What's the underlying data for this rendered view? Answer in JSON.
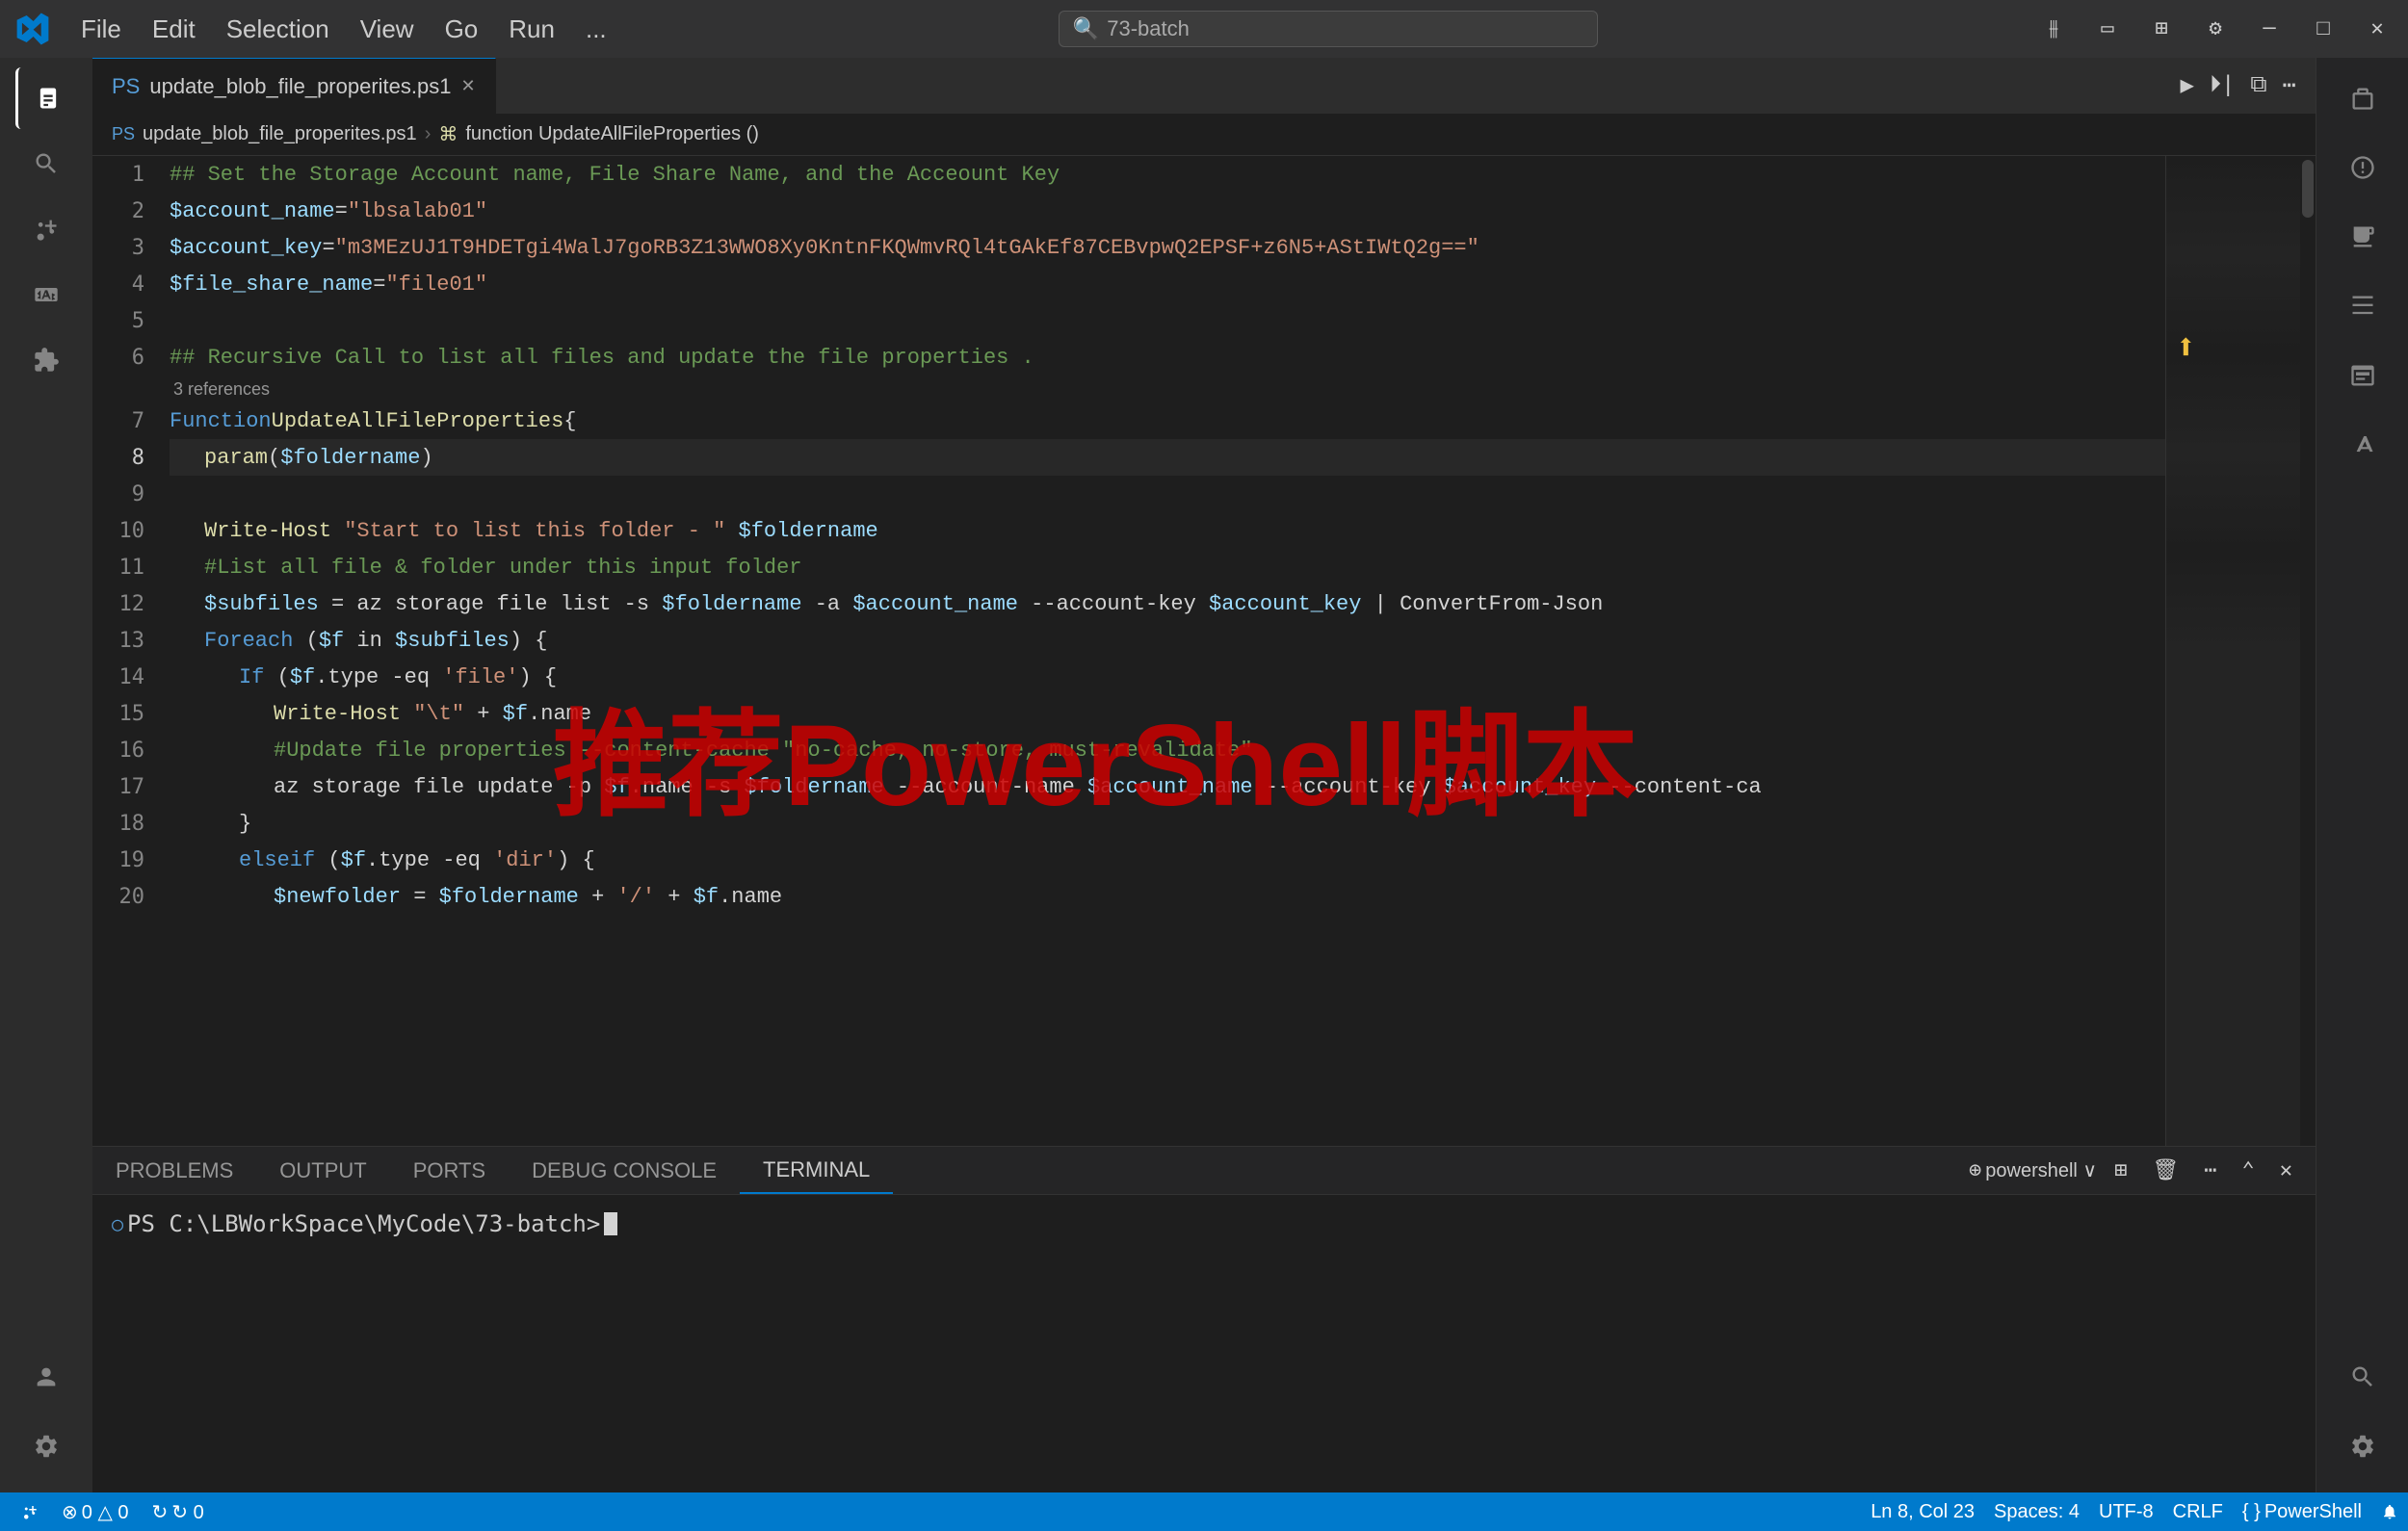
{
  "titleBar": {
    "logoAlt": "VS Code Logo",
    "menuItems": [
      "File",
      "Edit",
      "Selection",
      "View",
      "Go",
      "Run",
      "..."
    ],
    "searchPlaceholder": "73-batch",
    "windowControls": [
      "minimize",
      "maximize",
      "restore",
      "close"
    ]
  },
  "tabs": [
    {
      "label": "update_blob_file_properites.ps1",
      "active": true,
      "modified": false
    }
  ],
  "breadcrumb": {
    "parts": [
      "update_blob_file_properites.ps1",
      "function UpdateAllFileProperties ()"
    ]
  },
  "code": {
    "lines": [
      {
        "num": 1,
        "content": "## Set the Storage Account name, File Share Name, and the Acceount Key",
        "type": "comment"
      },
      {
        "num": 2,
        "content": "$account_name = \"lbsalab01\"",
        "type": "code"
      },
      {
        "num": 3,
        "content": "$account_key = \"m3MEzUJ1T9HDETgi4WalJ7goRB3Z13WWO8Xy0KntnFKQWmvRQl4tGAkEf87CEBvpwQ2EPSF+z6N5+AStIWtQ2g==\"",
        "type": "code"
      },
      {
        "num": 4,
        "content": "$file_share_name = \"file01\"",
        "type": "code"
      },
      {
        "num": 5,
        "content": "",
        "type": "empty"
      },
      {
        "num": 6,
        "content": "## Recursive Call to list all files and update the file properties .",
        "type": "comment"
      },
      {
        "num": "refs",
        "content": "3 references",
        "type": "refs"
      },
      {
        "num": 7,
        "content": "Function UpdateAllFileProperties {",
        "type": "code"
      },
      {
        "num": 8,
        "content": "    param($foldername)",
        "type": "code",
        "active": true
      },
      {
        "num": 9,
        "content": "",
        "type": "empty"
      },
      {
        "num": 10,
        "content": "    Write-Host \"Start to list this folder - \"  $foldername",
        "type": "code"
      },
      {
        "num": 11,
        "content": "    #List all file & folder under this input folder",
        "type": "comment"
      },
      {
        "num": 12,
        "content": "    $subfiles = az storage file list -s $foldername -a $account_name --account-key $account_key |  ConvertFrom-Json",
        "type": "code"
      },
      {
        "num": 13,
        "content": "    Foreach ($f in $subfiles) {",
        "type": "code"
      },
      {
        "num": 14,
        "content": "        If ($f.type -eq 'file') {",
        "type": "code"
      },
      {
        "num": 15,
        "content": "            Write-Host \"\\t\" + $f.name",
        "type": "code"
      },
      {
        "num": 16,
        "content": "            #Update file properties  --content-cache \"no-cache, no-store, must-revalidate\"",
        "type": "comment"
      },
      {
        "num": 17,
        "content": "            az storage file update -p $f.name -s $foldername --account-name $account_name --account-key $account_key --content-ca",
        "type": "code"
      },
      {
        "num": 18,
        "content": "        }",
        "type": "code"
      },
      {
        "num": 19,
        "content": "        elseif ($f.type -eq 'dir') {",
        "type": "code"
      },
      {
        "num": 20,
        "content": "            $newfolder = $foldername + '/' + $f.name",
        "type": "code"
      }
    ]
  },
  "panel": {
    "tabs": [
      "PROBLEMS",
      "OUTPUT",
      "PORTS",
      "DEBUG CONSOLE",
      "TERMINAL"
    ],
    "activeTab": "TERMINAL",
    "terminalShell": "powershell",
    "terminalPrompt": "PS C:\\LBWorkSpace\\MyCode\\73-batch> "
  },
  "statusBar": {
    "gitBranch": "0 △ 0",
    "warnings": "⚠ 0",
    "sync": "↻ 0",
    "cursorPosition": "Ln 8, Col 23",
    "spaces": "Spaces: 4",
    "encoding": "UTF-8",
    "lineEnding": "CRLF",
    "language": "PowerShell"
  },
  "watermark": {
    "line1": "推荐PowerShell脚本"
  },
  "icons": {
    "explorer": "⎇",
    "search": "🔍",
    "sourceControl": "⑂",
    "extensions": "⊞",
    "accounts": "👤",
    "settings": "⚙"
  }
}
